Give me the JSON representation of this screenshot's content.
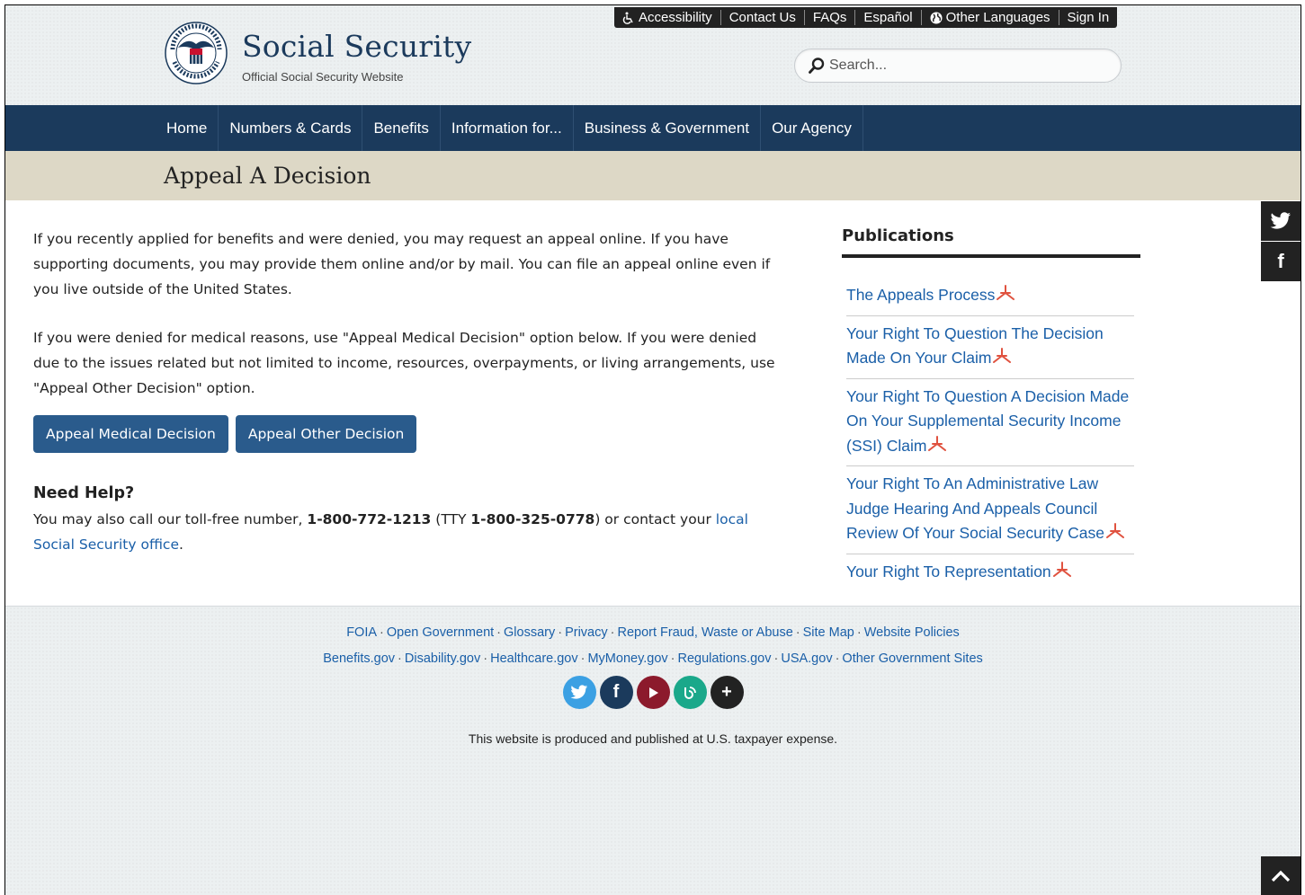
{
  "header": {
    "brand_title": "Social Security",
    "brand_subtitle": "Official Social Security Website",
    "utility_links": {
      "accessibility": "Accessibility",
      "contact": "Contact Us",
      "faqs": "FAQs",
      "espanol": "Español",
      "languages": "Other Languages",
      "signin": "Sign In"
    },
    "search_placeholder": "Search..."
  },
  "nav": {
    "items": [
      "Home",
      "Numbers & Cards",
      "Benefits",
      "Information for...",
      "Business & Government",
      "Our Agency"
    ]
  },
  "page": {
    "title": "Appeal A Decision",
    "para1": "If you recently applied for benefits and were denied, you may request an appeal online. If you have supporting documents, you may provide them online and/or by mail. You can file an appeal online even if you live outside of the United States.",
    "para2": "If you were denied for medical reasons, use \"Appeal Medical Decision\" option below. If you were denied due to the issues related but not limited to income, resources, overpayments, or living arrangements, use \"Appeal Other Decision\" option.",
    "btn_medical": "Appeal Medical Decision",
    "btn_other": "Appeal Other Decision",
    "help_title": "Need Help?",
    "help_prefix": "You may also call our toll-free number, ",
    "phone": "1-800-772-1213",
    "tty_prefix": " (TTY ",
    "tty": "1-800-325-0778",
    "tty_suffix": ") or contact your ",
    "office_link": "local Social Security office",
    "period": "."
  },
  "publications": {
    "title": "Publications",
    "items": [
      "The Appeals Process",
      "Your Right To Question The Decision Made On Your Claim",
      "Your Right To Question A Decision Made On Your Supplemental Security Income (SSI) Claim",
      "Your Right To An Administrative Law Judge Hearing And Appeals Council Review Of Your Social Security Case",
      "Your Right To Representation"
    ]
  },
  "side_social": {
    "twitter": "twitter-icon",
    "facebook": "f"
  },
  "footer": {
    "row1": [
      "FOIA",
      "Open Government",
      "Glossary",
      "Privacy",
      "Report Fraud, Waste or Abuse",
      "Site Map",
      "Website Policies"
    ],
    "row2": [
      "Benefits.gov",
      "Disability.gov",
      "Healthcare.gov",
      "MyMoney.gov",
      "Regulations.gov",
      "USA.gov",
      "Other Government Sites"
    ],
    "separator": "·",
    "circle_f": "f",
    "circle_plus": "+",
    "note": "This website is produced and published at U.S. taxpayer expense.",
    "colors": {
      "twitter": "#3ba0e3",
      "facebook": "#1b3a5c",
      "youtube": "#8c1a2c",
      "blog": "#1aa88a",
      "more": "#222222"
    }
  }
}
